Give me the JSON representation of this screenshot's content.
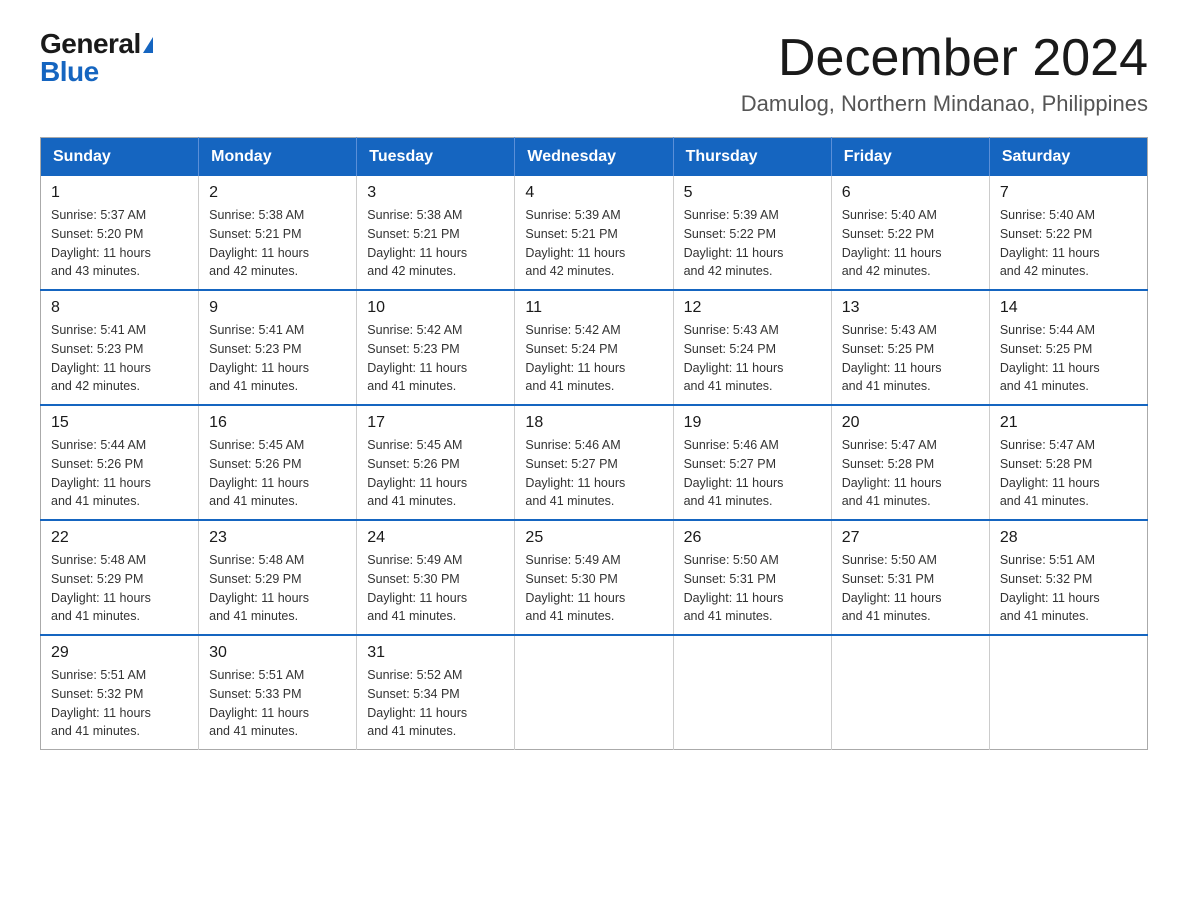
{
  "logo": {
    "general": "General",
    "blue": "Blue"
  },
  "title": "December 2024",
  "subtitle": "Damulog, Northern Mindanao, Philippines",
  "days_of_week": [
    "Sunday",
    "Monday",
    "Tuesday",
    "Wednesday",
    "Thursday",
    "Friday",
    "Saturday"
  ],
  "weeks": [
    [
      {
        "day": "1",
        "sunrise": "5:37 AM",
        "sunset": "5:20 PM",
        "daylight": "11 hours and 43 minutes."
      },
      {
        "day": "2",
        "sunrise": "5:38 AM",
        "sunset": "5:21 PM",
        "daylight": "11 hours and 42 minutes."
      },
      {
        "day": "3",
        "sunrise": "5:38 AM",
        "sunset": "5:21 PM",
        "daylight": "11 hours and 42 minutes."
      },
      {
        "day": "4",
        "sunrise": "5:39 AM",
        "sunset": "5:21 PM",
        "daylight": "11 hours and 42 minutes."
      },
      {
        "day": "5",
        "sunrise": "5:39 AM",
        "sunset": "5:22 PM",
        "daylight": "11 hours and 42 minutes."
      },
      {
        "day": "6",
        "sunrise": "5:40 AM",
        "sunset": "5:22 PM",
        "daylight": "11 hours and 42 minutes."
      },
      {
        "day": "7",
        "sunrise": "5:40 AM",
        "sunset": "5:22 PM",
        "daylight": "11 hours and 42 minutes."
      }
    ],
    [
      {
        "day": "8",
        "sunrise": "5:41 AM",
        "sunset": "5:23 PM",
        "daylight": "11 hours and 42 minutes."
      },
      {
        "day": "9",
        "sunrise": "5:41 AM",
        "sunset": "5:23 PM",
        "daylight": "11 hours and 41 minutes."
      },
      {
        "day": "10",
        "sunrise": "5:42 AM",
        "sunset": "5:23 PM",
        "daylight": "11 hours and 41 minutes."
      },
      {
        "day": "11",
        "sunrise": "5:42 AM",
        "sunset": "5:24 PM",
        "daylight": "11 hours and 41 minutes."
      },
      {
        "day": "12",
        "sunrise": "5:43 AM",
        "sunset": "5:24 PM",
        "daylight": "11 hours and 41 minutes."
      },
      {
        "day": "13",
        "sunrise": "5:43 AM",
        "sunset": "5:25 PM",
        "daylight": "11 hours and 41 minutes."
      },
      {
        "day": "14",
        "sunrise": "5:44 AM",
        "sunset": "5:25 PM",
        "daylight": "11 hours and 41 minutes."
      }
    ],
    [
      {
        "day": "15",
        "sunrise": "5:44 AM",
        "sunset": "5:26 PM",
        "daylight": "11 hours and 41 minutes."
      },
      {
        "day": "16",
        "sunrise": "5:45 AM",
        "sunset": "5:26 PM",
        "daylight": "11 hours and 41 minutes."
      },
      {
        "day": "17",
        "sunrise": "5:45 AM",
        "sunset": "5:26 PM",
        "daylight": "11 hours and 41 minutes."
      },
      {
        "day": "18",
        "sunrise": "5:46 AM",
        "sunset": "5:27 PM",
        "daylight": "11 hours and 41 minutes."
      },
      {
        "day": "19",
        "sunrise": "5:46 AM",
        "sunset": "5:27 PM",
        "daylight": "11 hours and 41 minutes."
      },
      {
        "day": "20",
        "sunrise": "5:47 AM",
        "sunset": "5:28 PM",
        "daylight": "11 hours and 41 minutes."
      },
      {
        "day": "21",
        "sunrise": "5:47 AM",
        "sunset": "5:28 PM",
        "daylight": "11 hours and 41 minutes."
      }
    ],
    [
      {
        "day": "22",
        "sunrise": "5:48 AM",
        "sunset": "5:29 PM",
        "daylight": "11 hours and 41 minutes."
      },
      {
        "day": "23",
        "sunrise": "5:48 AM",
        "sunset": "5:29 PM",
        "daylight": "11 hours and 41 minutes."
      },
      {
        "day": "24",
        "sunrise": "5:49 AM",
        "sunset": "5:30 PM",
        "daylight": "11 hours and 41 minutes."
      },
      {
        "day": "25",
        "sunrise": "5:49 AM",
        "sunset": "5:30 PM",
        "daylight": "11 hours and 41 minutes."
      },
      {
        "day": "26",
        "sunrise": "5:50 AM",
        "sunset": "5:31 PM",
        "daylight": "11 hours and 41 minutes."
      },
      {
        "day": "27",
        "sunrise": "5:50 AM",
        "sunset": "5:31 PM",
        "daylight": "11 hours and 41 minutes."
      },
      {
        "day": "28",
        "sunrise": "5:51 AM",
        "sunset": "5:32 PM",
        "daylight": "11 hours and 41 minutes."
      }
    ],
    [
      {
        "day": "29",
        "sunrise": "5:51 AM",
        "sunset": "5:32 PM",
        "daylight": "11 hours and 41 minutes."
      },
      {
        "day": "30",
        "sunrise": "5:51 AM",
        "sunset": "5:33 PM",
        "daylight": "11 hours and 41 minutes."
      },
      {
        "day": "31",
        "sunrise": "5:52 AM",
        "sunset": "5:34 PM",
        "daylight": "11 hours and 41 minutes."
      },
      null,
      null,
      null,
      null
    ]
  ],
  "labels": {
    "sunrise": "Sunrise:",
    "sunset": "Sunset:",
    "daylight": "Daylight:"
  }
}
